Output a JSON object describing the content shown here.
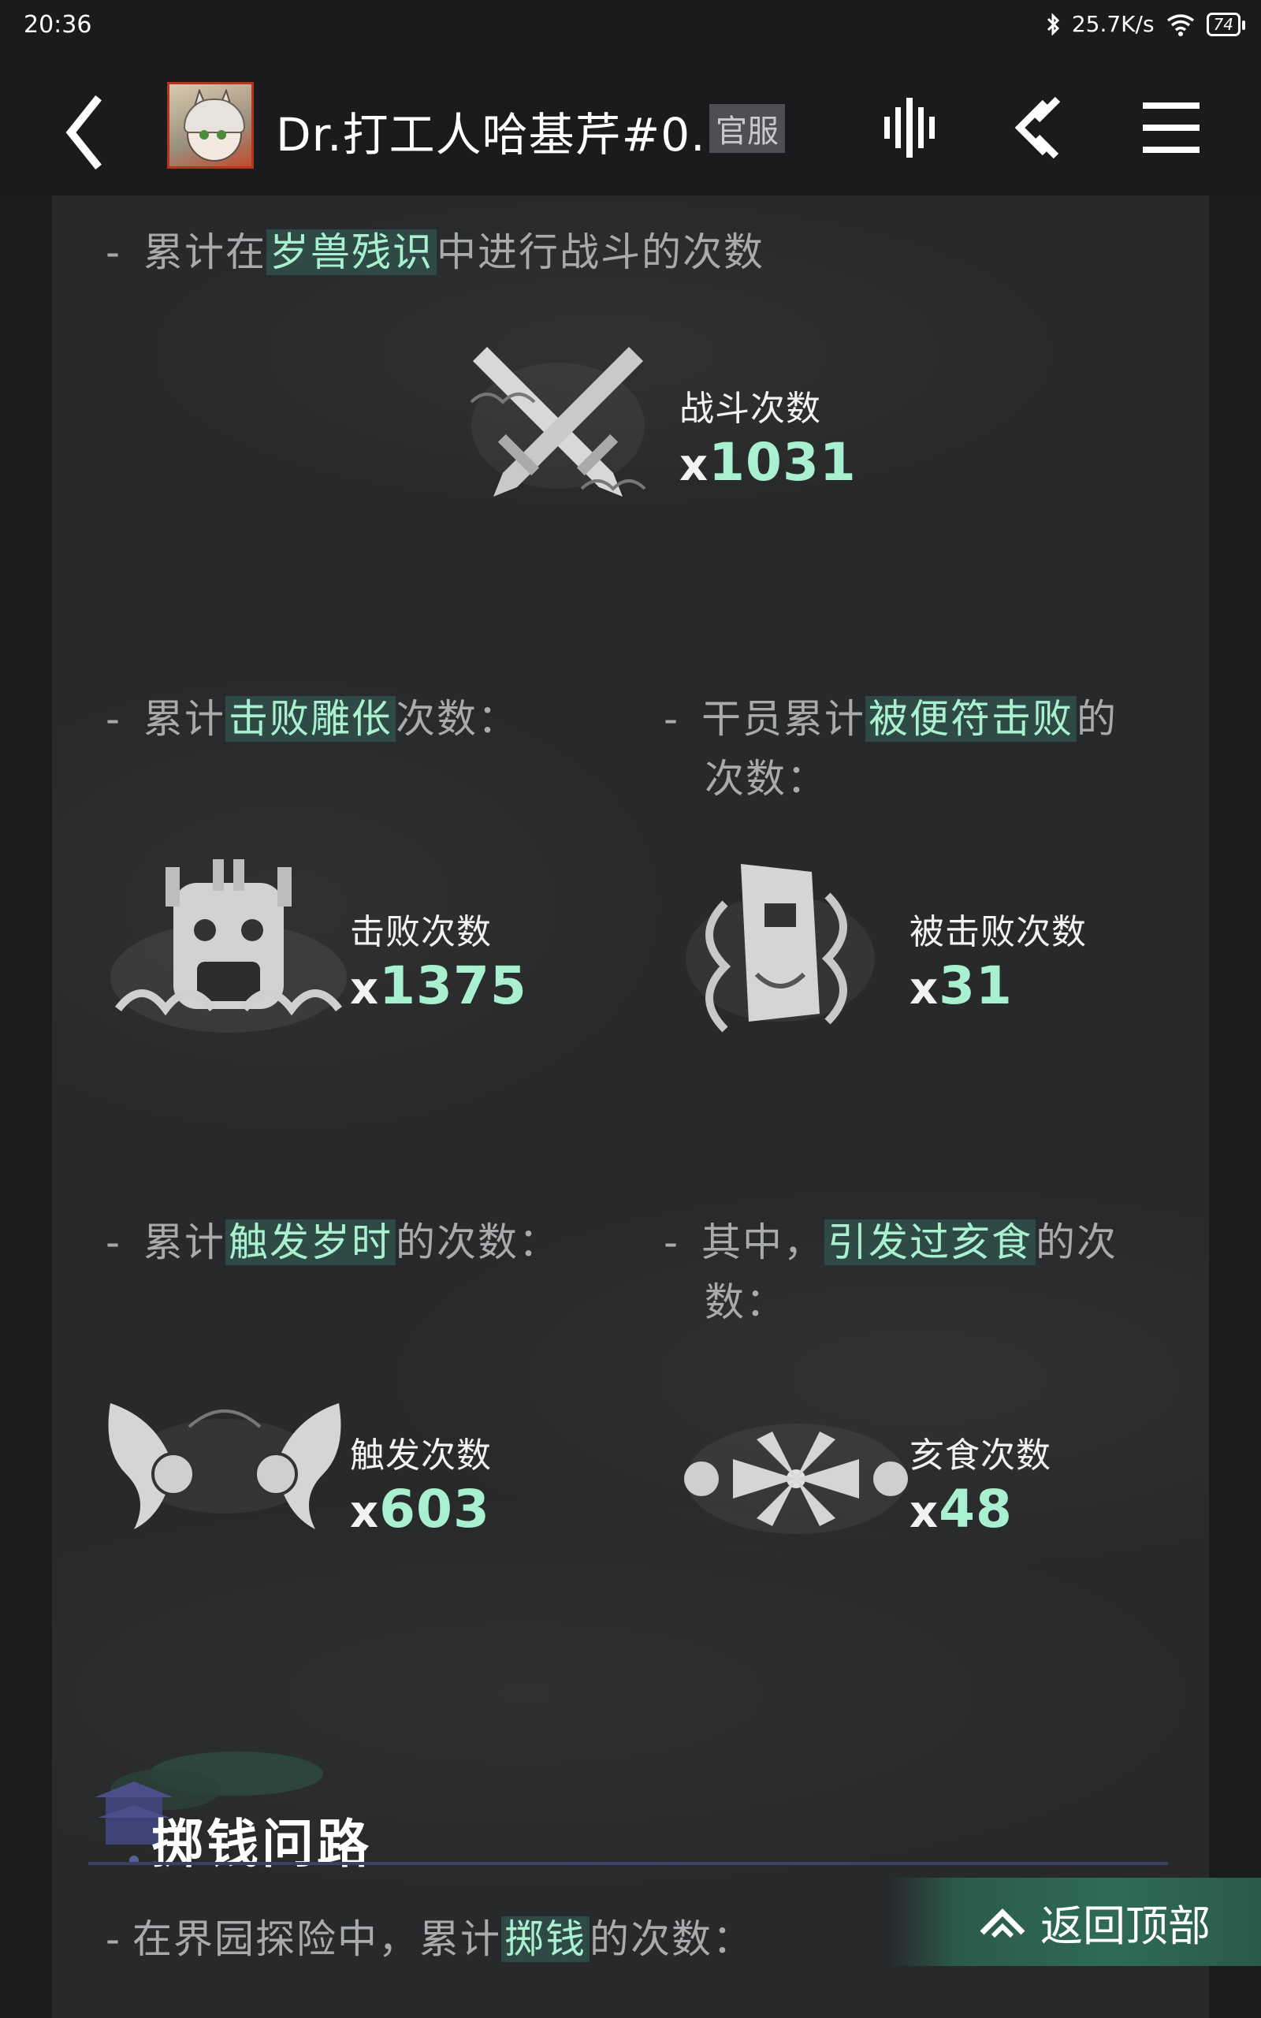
{
  "status_bar": {
    "time": "20:36",
    "net_speed": "25.7K/s",
    "battery": "74"
  },
  "nav": {
    "title": "Dr.打工人哈基芹#0...",
    "badge": "官服"
  },
  "sections": {
    "battles": {
      "pre": "累计在",
      "highlight": "岁兽残识",
      "post": "中进行战斗的次数",
      "label": "战斗次数",
      "value": "1031"
    },
    "defeat": {
      "pre": "累计",
      "highlight": "击败雕伥",
      "post": "次数：",
      "label": "击败次数",
      "value": "1375"
    },
    "defeated": {
      "pre": "干员累计",
      "highlight": "被便符击败",
      "post": "的",
      "post2": "次数：",
      "label": "被击败次数",
      "value": "31"
    },
    "trigger": {
      "pre": "累计",
      "highlight": "触发岁时",
      "post": "的次数：",
      "label": "触发次数",
      "value": "603"
    },
    "haishi": {
      "pre": "其中，",
      "highlight": "引发过亥食",
      "post": "的次",
      "post2": "数：",
      "label": "亥食次数",
      "value": "48"
    }
  },
  "coin_section": {
    "title": "掷钱问路",
    "pre": "在界园探险中，累计",
    "highlight": "掷钱",
    "post": "的次数："
  },
  "back_to_top": "返回顶部",
  "value_prefix": "x",
  "dash": "-",
  "colors": {
    "highlight_text": "#a8f0d0",
    "highlight_bg": "#2f4a45",
    "panel_bg": "#27292b"
  }
}
